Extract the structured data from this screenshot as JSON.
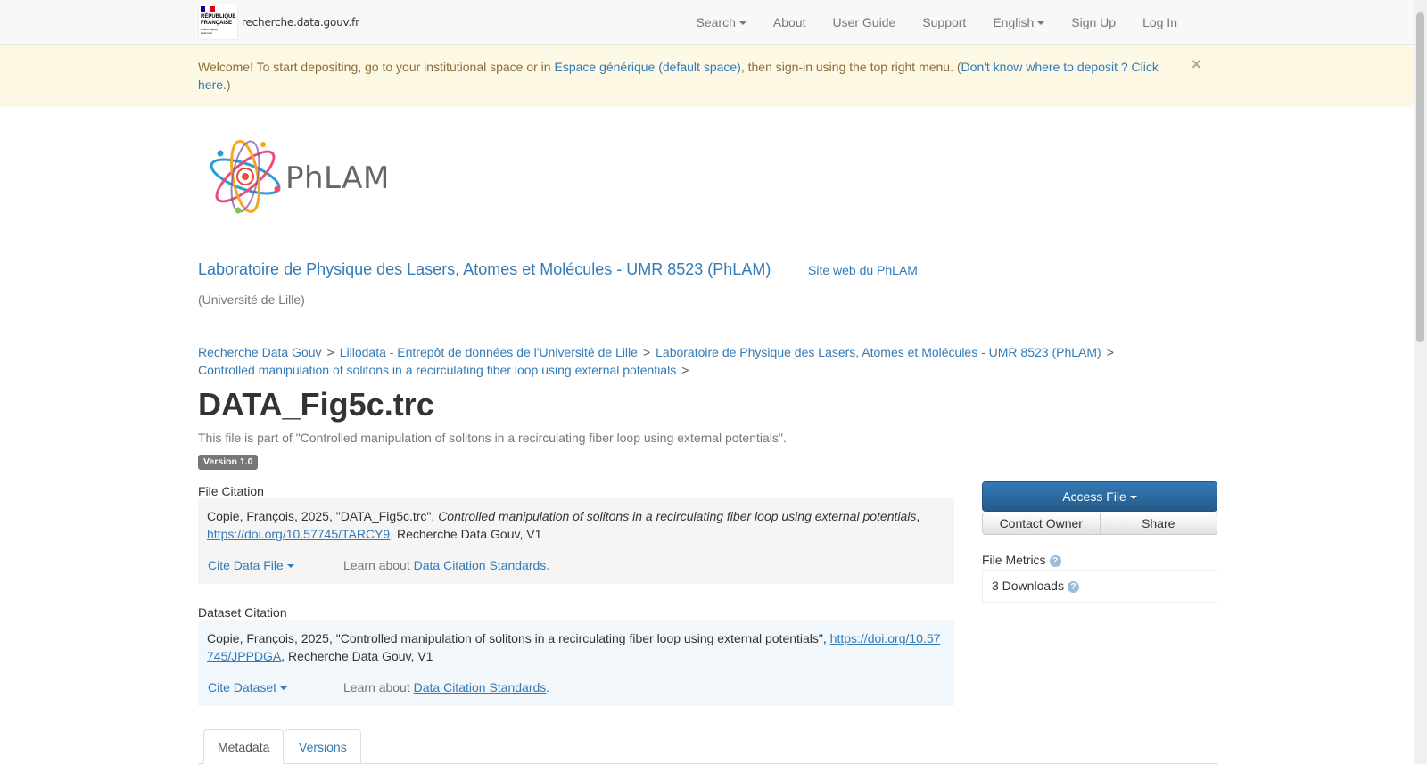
{
  "navbar": {
    "gov_lines": [
      "RÉPUBLIQUE",
      "FRANÇAISE"
    ],
    "gov_motto": "Liberté Égalité Fraternité",
    "site_name": "recherche.data.gouv.fr",
    "items": [
      {
        "label": "Search",
        "dropdown": true
      },
      {
        "label": "About",
        "dropdown": false
      },
      {
        "label": "User Guide",
        "dropdown": false
      },
      {
        "label": "Support",
        "dropdown": false
      },
      {
        "label": "English",
        "dropdown": true
      },
      {
        "label": "Sign Up",
        "dropdown": false
      },
      {
        "label": "Log In",
        "dropdown": false
      }
    ]
  },
  "alert": {
    "text_before": "Welcome! To start depositing, go to your institutional space or in ",
    "link1": "Espace générique (default space)",
    "text_middle": ", then sign-in using the top right menu. (",
    "link2": "Don't know where to deposit ? Click here.",
    "text_after": ")",
    "close": "×"
  },
  "dataverse": {
    "logo_text": "PhLAM",
    "name": "Laboratoire de Physique des Lasers, Atomes et Molécules - UMR 8523 (PhLAM)",
    "site_link": "Site web du PhLAM",
    "affiliation": "(Université de Lille)"
  },
  "breadcrumb": [
    "Recherche Data Gouv",
    "Lillodata - Entrepôt de données de l'Université de Lille",
    "Laboratoire de Physique des Lasers, Atomes et Molécules - UMR 8523 (PhLAM)",
    "Controlled manipulation of solitons in a recirculating fiber loop using external potentials"
  ],
  "breadcrumb_sep": ">",
  "file": {
    "title": "DATA_Fig5c.trc",
    "part_of": "This file is part of \"Controlled manipulation of solitons in a recirculating fiber loop using external potentials\".",
    "version": "Version 1.0"
  },
  "file_citation": {
    "heading": "File Citation",
    "prefix": "Copie, François, 2025, \"DATA_Fig5c.trc\", ",
    "dataset_title_italic": "Controlled manipulation of solitons in a recirculating fiber loop using external potentials",
    "sep": ", ",
    "doi": "https://doi.org/10.57745/TARCY9",
    "suffix": ", Recherche Data Gouv, V1",
    "cite_label": "Cite Data File",
    "learn_prefix": "Learn about ",
    "learn_link": "Data Citation Standards",
    "learn_suffix": "."
  },
  "dataset_citation": {
    "heading": "Dataset Citation",
    "prefix": "Copie, François, 2025, \"Controlled manipulation of solitons in a recirculating fiber loop using external potentials\", ",
    "doi": "https://doi.org/10.57745/JPPDGA",
    "suffix": ", Recherche Data Gouv, V1",
    "cite_label": "Cite Dataset",
    "learn_prefix": "Learn about ",
    "learn_link": "Data Citation Standards",
    "learn_suffix": "."
  },
  "actions": {
    "access_file": "Access File",
    "contact_owner": "Contact Owner",
    "share": "Share"
  },
  "metrics": {
    "heading": "File Metrics",
    "downloads": "3 Downloads",
    "help_glyph": "?"
  },
  "tabs": [
    {
      "label": "Metadata",
      "active": true
    },
    {
      "label": "Versions",
      "active": false
    }
  ],
  "colors": {
    "link": "#337ab7",
    "alert_bg": "#fcf8e3",
    "alert_text": "#8a6d3b",
    "primary_btn": "#337ab7",
    "version_badge": "#777777"
  }
}
